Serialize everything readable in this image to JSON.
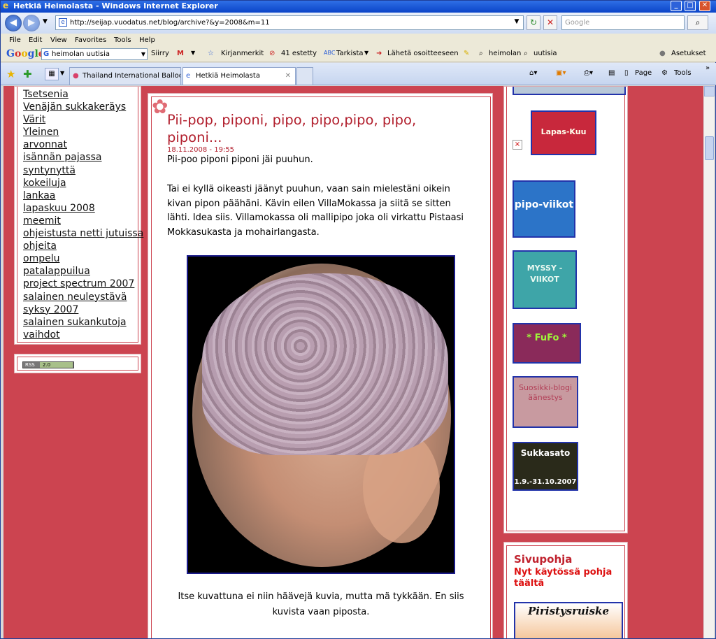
{
  "window": {
    "title": "Hetkiä Heimolasta - Windows Internet Explorer"
  },
  "address": {
    "url": "http://seijap.vuodatus.net/blog/archive?&y=2008&m=11",
    "search_placeholder": "Google"
  },
  "menu": [
    "File",
    "Edit",
    "View",
    "Favorites",
    "Tools",
    "Help"
  ],
  "google_toolbar": {
    "logo": "Google",
    "search_value": "heimolan uutisia",
    "go": "Siirry",
    "gmail": "M",
    "bookmarks": "Kirjanmerkit",
    "blocked": "41 estetty",
    "check": "Tarkista",
    "send": "Lähetä osoitteeseen",
    "word1": "heimolan",
    "word2": "uutisia",
    "settings": "Asetukset"
  },
  "tabs": [
    {
      "label": "Thailand International Balloo..."
    },
    {
      "label": "Hetkiä Heimolasta"
    }
  ],
  "command_bar": {
    "page": "Page",
    "tools": "Tools"
  },
  "sidebar": {
    "categories": [
      "Tsetsenia",
      "Venäjän sukkakeräys",
      "Värit",
      "Yleinen",
      "arvonnat",
      "isännän pajassa",
      "syntynyttä",
      "kokeiluja",
      "lankaa",
      "lapaskuu 2008",
      "meemit",
      "ohjeistusta netti jutuissa",
      "ohjeita",
      "ompelu",
      "patalappuilua",
      "project spectrum 2007",
      "salainen neuleystävä",
      "syksy 2007",
      "salainen sukankutoja",
      "vaihdot"
    ],
    "rss": "RSS",
    "rss_ver": "2.0"
  },
  "post": {
    "title": "Pii-pop, piponi, pipo, pipo,pipo, pipo, piponi...",
    "date": "18.11.2008 - 19:55",
    "p1": "Pii-poo piponi piponi jäi puuhun.",
    "p2": "Tai ei kyllä oikeasti jäänyt puuhun, vaan sain mielestäni oikein kivan pipon päähäni. Kävin eilen VillaMokassa ja siitä se sitten lähti. Idea siis. Villamokassa oli mallipipo joka oli virkattu Pistaasi Mokkasukasta ja mohairlangasta.",
    "caption": "Itse kuvattuna ei niin häävejä kuvia, mutta mä tykkään. En siis kuvista vaan piposta."
  },
  "right": {
    "badges": [
      "Lapas-Kuu",
      "pipo-viikot",
      "MYSSY - VIIKOT",
      "* FuFo *",
      "Suosikki-blogi äänestys",
      "Sukkasato",
      "1.9.-31.10.2007"
    ],
    "broken": "×",
    "sivupohja_title": "Sivupohja",
    "sivupohja_text": "Nyt käytössä pohja täältä",
    "piristys": "Piristysruiske"
  },
  "colors": {
    "page_bg": "#cc4450",
    "title": "#b2202e"
  }
}
